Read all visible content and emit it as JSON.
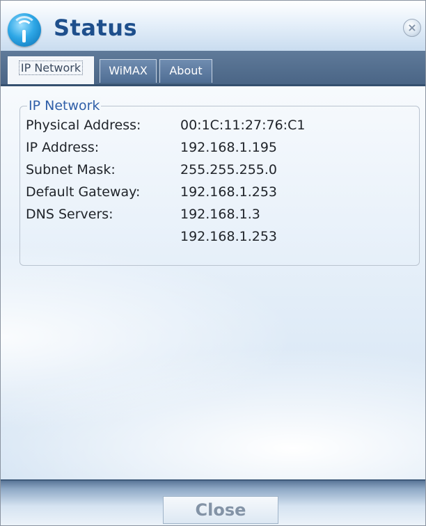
{
  "window": {
    "title": "Status"
  },
  "tabs": [
    {
      "label": "IP Network",
      "active": true
    },
    {
      "label": "WiMAX",
      "active": false
    },
    {
      "label": "About",
      "active": false
    }
  ],
  "ip_network": {
    "group_title": "IP Network",
    "rows": [
      {
        "label": "Physical Address:",
        "value": "00:1C:11:27:76:C1"
      },
      {
        "label": "IP Address:",
        "value": "192.168.1.195"
      },
      {
        "label": "Subnet Mask:",
        "value": "255.255.255.0"
      },
      {
        "label": "Default Gateway:",
        "value": "192.168.1.253"
      },
      {
        "label": "DNS Servers:",
        "value": "192.168.1.3"
      },
      {
        "label": "",
        "value": "192.168.1.253"
      }
    ]
  },
  "buttons": {
    "close_label": "Close"
  },
  "icons": {
    "app": "wireless-signal-icon",
    "window_close": "close-icon"
  },
  "colors": {
    "title": "#1e4f8c",
    "tabstrip": "#4f6a8c",
    "group_title": "#2f5fa8"
  }
}
